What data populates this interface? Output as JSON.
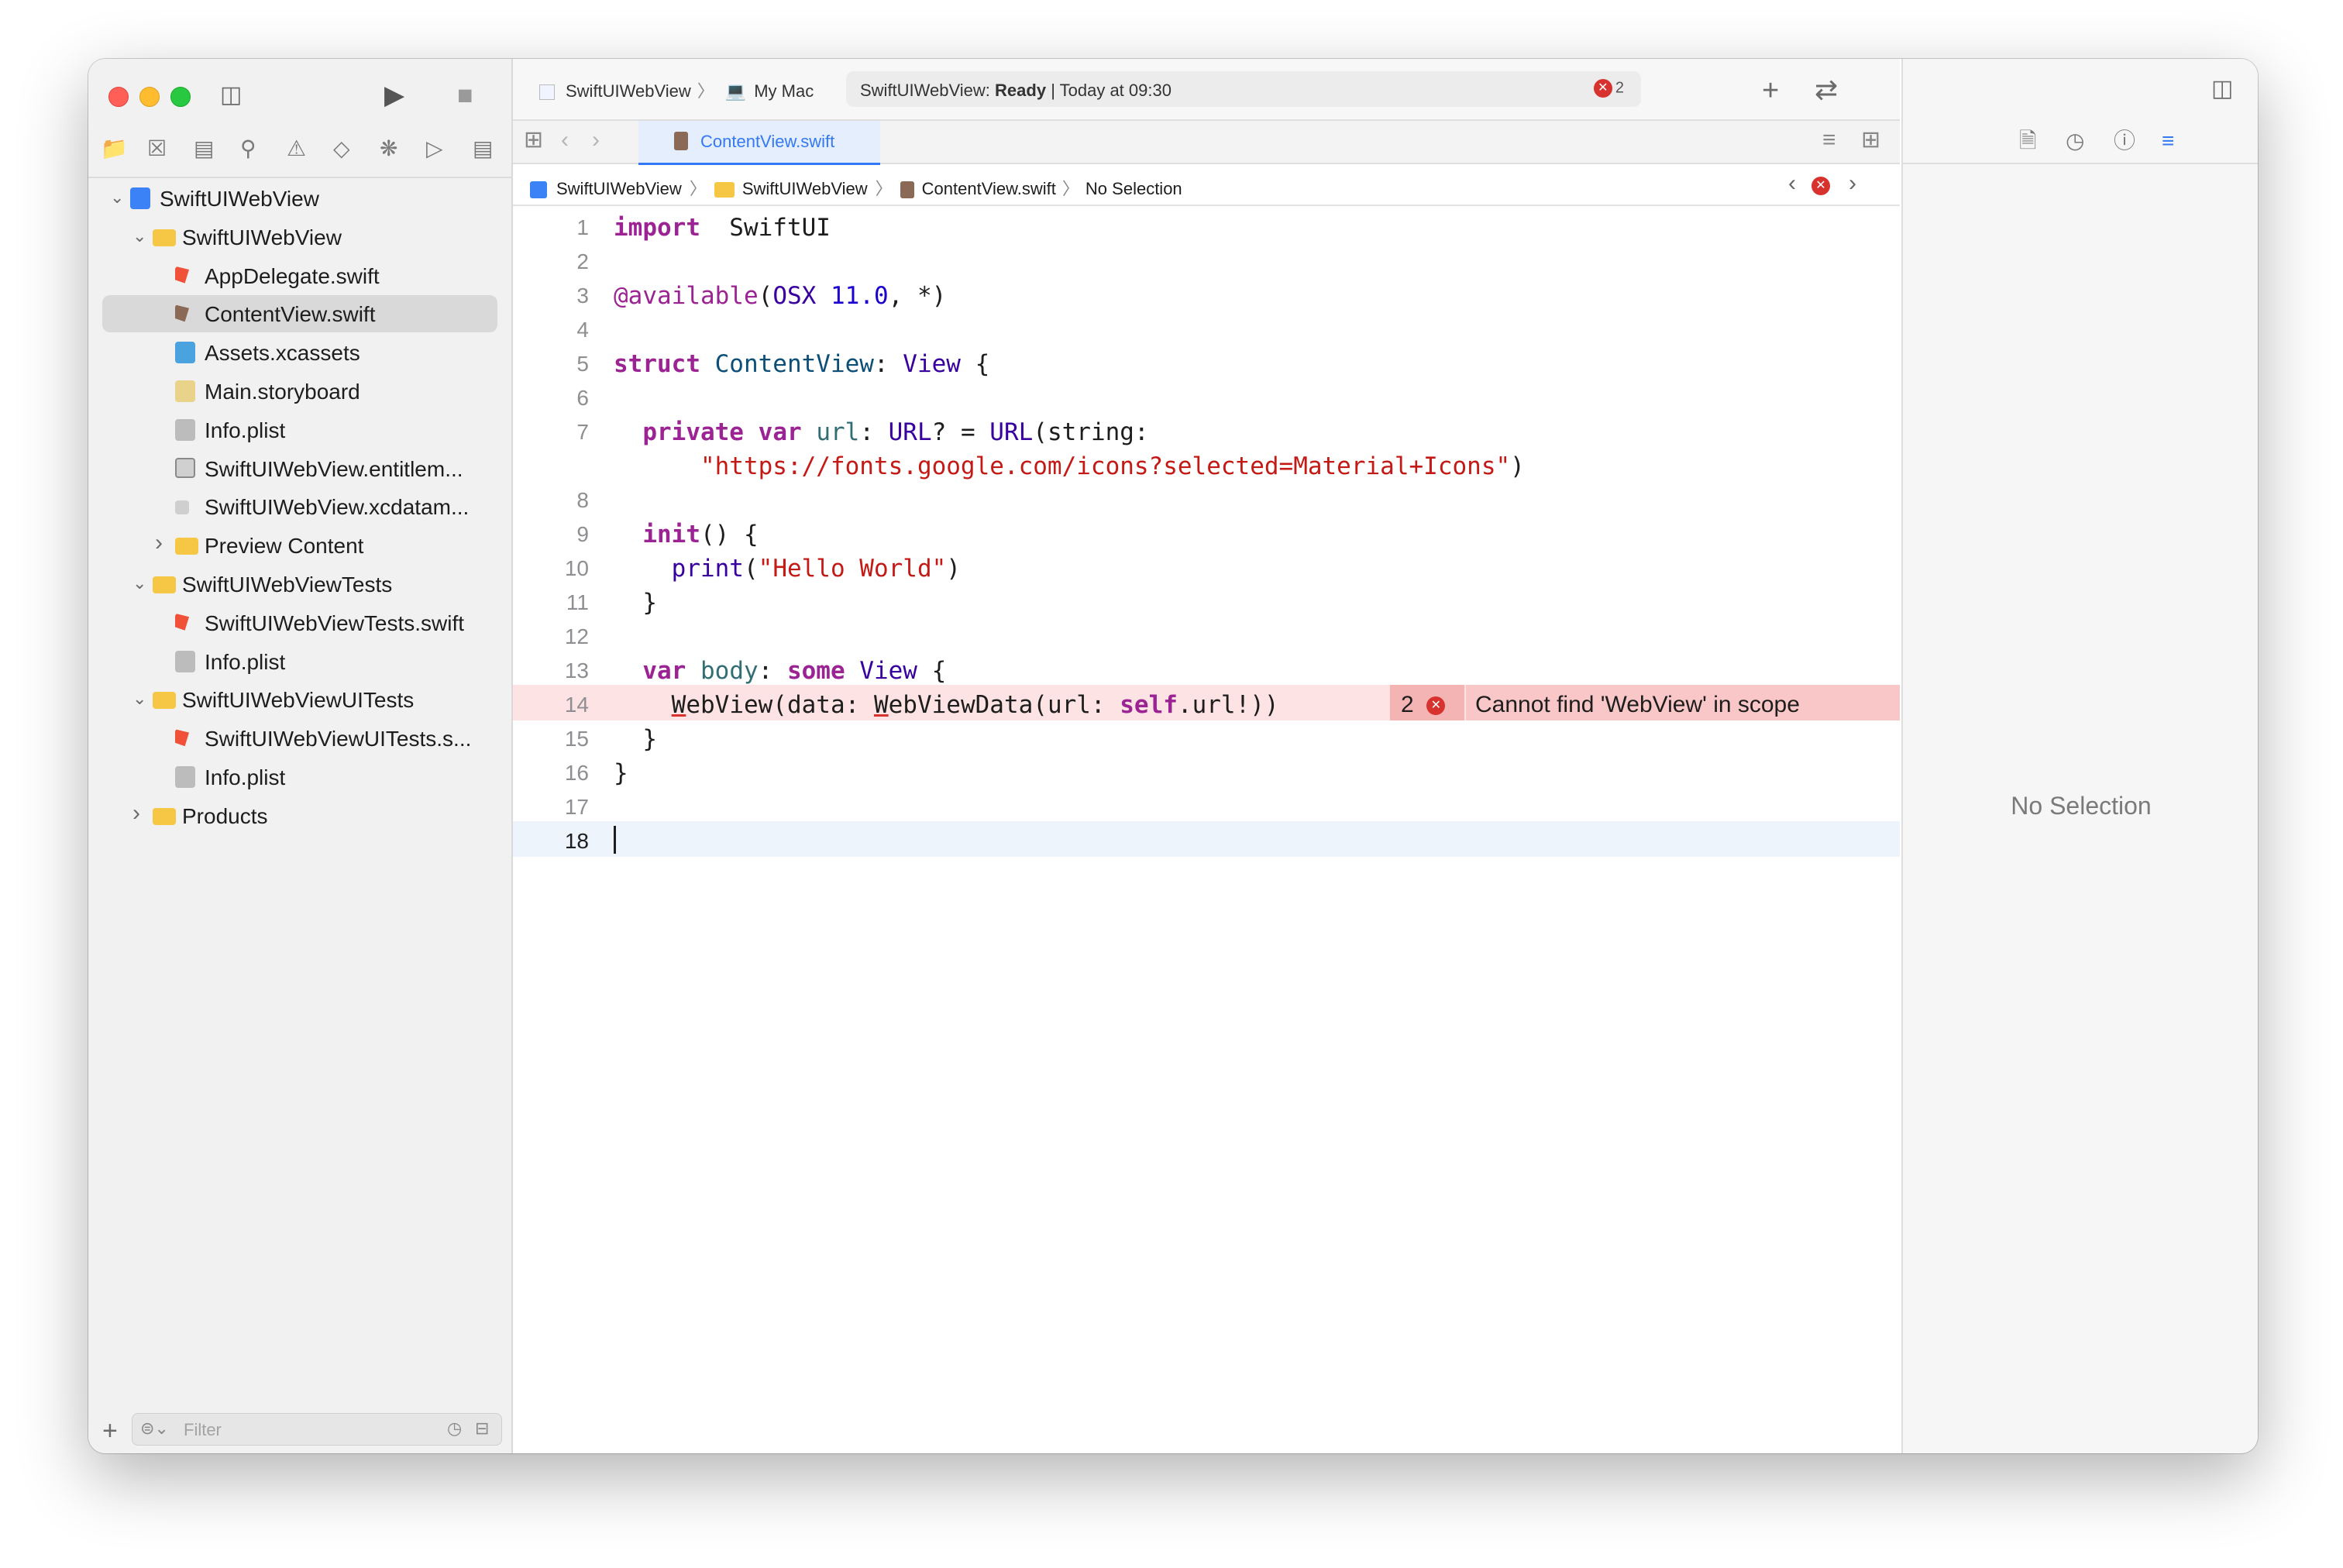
{
  "window": {
    "scheme": {
      "project": "SwiftUIWebView",
      "destination": "My Mac"
    },
    "status": {
      "prefix": "SwiftUIWebView: ",
      "state": "Ready",
      "separator": " | ",
      "time": "Today at 09:30",
      "error_count": "2"
    }
  },
  "navigator": {
    "tree": [
      {
        "label": "SwiftUIWebView",
        "icon": "project-icon",
        "level": 0,
        "disclosure": "open"
      },
      {
        "label": "SwiftUIWebView",
        "icon": "folder-icon",
        "level": 1,
        "disclosure": "open"
      },
      {
        "label": "AppDelegate.swift",
        "icon": "swift-file-icon",
        "level": 2
      },
      {
        "label": "ContentView.swift",
        "icon": "swift-file-icon",
        "level": 2,
        "selected": true
      },
      {
        "label": "Assets.xcassets",
        "icon": "asset-catalog-icon",
        "level": 2
      },
      {
        "label": "Main.storyboard",
        "icon": "storyboard-icon",
        "level": 2
      },
      {
        "label": "Info.plist",
        "icon": "plist-icon",
        "level": 2
      },
      {
        "label": "SwiftUIWebView.entitlem...",
        "icon": "entitlements-icon",
        "level": 2
      },
      {
        "label": "SwiftUIWebView.xcdatam...",
        "icon": "data-model-icon",
        "level": 2
      },
      {
        "label": "Preview Content",
        "icon": "folder-icon",
        "level": 2,
        "disclosure": "closed"
      },
      {
        "label": "SwiftUIWebViewTests",
        "icon": "folder-icon",
        "level": 1,
        "disclosure": "open"
      },
      {
        "label": "SwiftUIWebViewTests.swift",
        "icon": "swift-file-icon",
        "level": 2
      },
      {
        "label": "Info.plist",
        "icon": "plist-icon",
        "level": 2
      },
      {
        "label": "SwiftUIWebViewUITests",
        "icon": "folder-icon",
        "level": 1,
        "disclosure": "open"
      },
      {
        "label": "SwiftUIWebViewUITests.s...",
        "icon": "swift-file-icon",
        "level": 2
      },
      {
        "label": "Info.plist",
        "icon": "plist-icon",
        "level": 2
      },
      {
        "label": "Products",
        "icon": "folder-icon",
        "level": 1,
        "disclosure": "closed"
      }
    ],
    "filter": {
      "placeholder": "Filter"
    }
  },
  "editor": {
    "tab": {
      "label": "ContentView.swift"
    },
    "jumpbar": [
      "SwiftUIWebView",
      "SwiftUIWebView",
      "ContentView.swift",
      "No Selection"
    ],
    "lines": [
      {
        "n": "1",
        "tokens": [
          [
            "kw",
            "import"
          ],
          [
            "",
            "  SwiftUI"
          ]
        ]
      },
      {
        "n": "2",
        "tokens": []
      },
      {
        "n": "3",
        "tokens": [
          [
            "at",
            "@available"
          ],
          [
            "",
            "("
          ],
          [
            "ty",
            "OSX"
          ],
          [
            "nm",
            " 11.0"
          ],
          [
            "",
            ", *)"
          ]
        ]
      },
      {
        "n": "4",
        "tokens": []
      },
      {
        "n": "5",
        "tokens": [
          [
            "kw",
            "struct"
          ],
          [
            "tn",
            " ContentView"
          ],
          [
            "",
            ": "
          ],
          [
            "ty",
            "View"
          ],
          [
            "",
            " {"
          ]
        ]
      },
      {
        "n": "6",
        "tokens": []
      },
      {
        "n": "7",
        "tokens": [
          [
            "",
            "  "
          ],
          [
            "kw",
            "private"
          ],
          [
            "",
            " "
          ],
          [
            "kw",
            "var"
          ],
          [
            "id",
            " url"
          ],
          [
            "",
            ": "
          ],
          [
            "ty",
            "URL"
          ],
          [
            "",
            "? = "
          ],
          [
            "ty",
            "URL"
          ],
          [
            "",
            "(string:"
          ]
        ]
      },
      {
        "n": "",
        "tokens": [
          [
            "",
            "      "
          ],
          [
            "st",
            "\"https://fonts.google.com/icons?selected=Material+Icons\""
          ],
          [
            "",
            ")"
          ]
        ]
      },
      {
        "n": "8",
        "tokens": []
      },
      {
        "n": "9",
        "tokens": [
          [
            "",
            "  "
          ],
          [
            "kw",
            "init"
          ],
          [
            "",
            "() {"
          ]
        ]
      },
      {
        "n": "10",
        "tokens": [
          [
            "",
            "    "
          ],
          [
            "ty",
            "print"
          ],
          [
            "",
            "("
          ],
          [
            "st",
            "\"Hello World\""
          ],
          [
            "",
            ")"
          ]
        ]
      },
      {
        "n": "11",
        "tokens": [
          [
            "",
            "  }"
          ]
        ]
      },
      {
        "n": "12",
        "tokens": []
      },
      {
        "n": "13",
        "tokens": [
          [
            "",
            "  "
          ],
          [
            "kw",
            "var"
          ],
          [
            "id",
            " body"
          ],
          [
            "",
            ": "
          ],
          [
            "kw",
            "some"
          ],
          [
            "",
            " "
          ],
          [
            "ty",
            "View"
          ],
          [
            "",
            " {"
          ]
        ]
      },
      {
        "n": "14",
        "tokens": [
          [
            "",
            "    "
          ],
          [
            "und",
            "W"
          ],
          [
            "",
            "ebView(data: "
          ],
          [
            "und",
            "W"
          ],
          [
            "",
            "ebViewData(url: "
          ],
          [
            "kw",
            "self"
          ],
          [
            "",
            ".url!))"
          ]
        ],
        "error": true
      },
      {
        "n": "15",
        "tokens": [
          [
            "",
            "  }"
          ]
        ]
      },
      {
        "n": "16",
        "tokens": [
          [
            "",
            "}"
          ]
        ]
      },
      {
        "n": "17",
        "tokens": []
      },
      {
        "n": "18",
        "tokens": [],
        "current": true
      }
    ],
    "error": {
      "count": "2",
      "message": "Cannot find 'WebView' in scope"
    }
  },
  "inspector": {
    "empty_label": "No Selection"
  },
  "colors": {
    "accent": "#3478f6",
    "error": "#d7322d",
    "keyword": "#9b2393",
    "string": "#c41a16"
  }
}
